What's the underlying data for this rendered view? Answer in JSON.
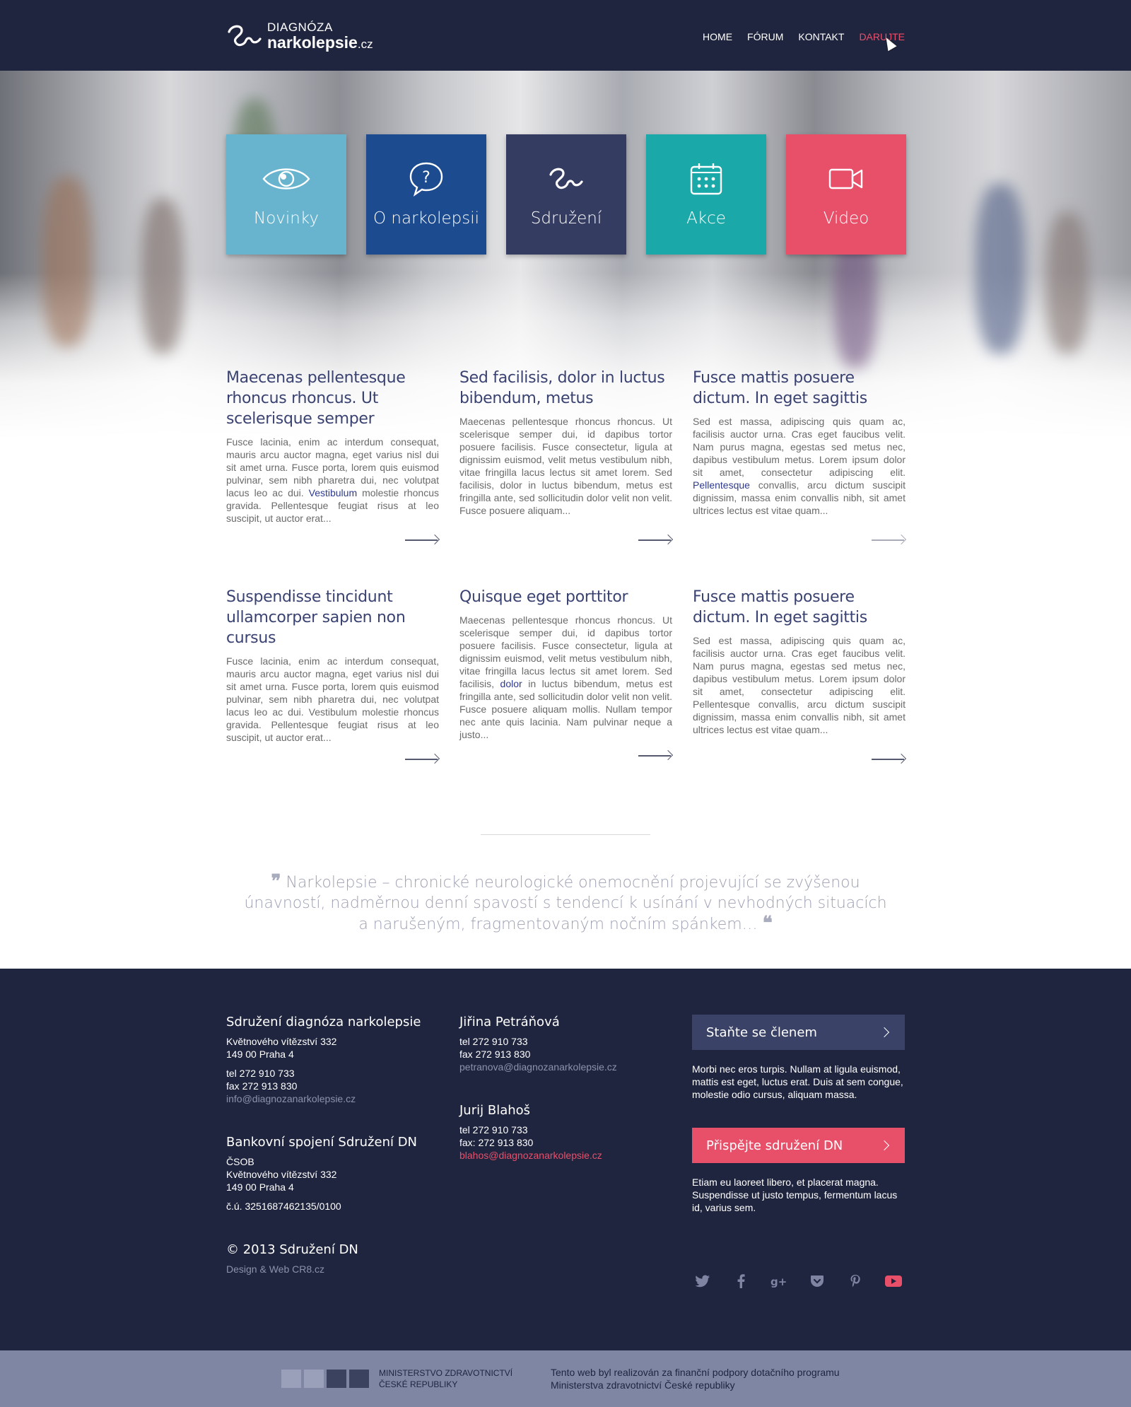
{
  "header": {
    "logo_top": "DIAGNÓZA",
    "logo_main": "narkolepsie",
    "logo_tld": ".cz",
    "nav": [
      "HOME",
      "FÓRUM",
      "KONTAKT",
      "DARUJTE"
    ]
  },
  "tiles": [
    {
      "label": "Novinky",
      "icon": "eye-icon",
      "color": "#68b4cf"
    },
    {
      "label": "O narkolepsii",
      "icon": "question-bubble-icon",
      "color": "#1d4b8f"
    },
    {
      "label": "Sdružení",
      "icon": "logo-mark-icon",
      "color": "#353c62"
    },
    {
      "label": "Akce",
      "icon": "calendar-icon",
      "color": "#1aa9a8"
    },
    {
      "label": "Video",
      "icon": "video-camera-icon",
      "color": "#e8506a"
    }
  ],
  "articles": [
    {
      "title": "Maecenas pellentesque rhoncus rhoncus. Ut scelerisque semper",
      "text_a": "Fusce lacinia, enim ac interdum consequat, mauris arcu auctor magna, eget varius nisl dui sit amet urna. Fusce porta, lorem quis euismod pulvinar, sem nibh pharetra dui, nec volutpat lacus leo ac dui. ",
      "link": "Vestibulum",
      "text_b": " molestie rhoncus gravida. Pellentesque feugiat risus at leo suscipit, ut auctor erat..."
    },
    {
      "title": "Sed facilisis, dolor in luctus bibendum, metus",
      "text_a": "Maecenas pellentesque rhoncus rhoncus. Ut scelerisque semper dui, id dapibus tortor posuere facilisis. Fusce consectetur, ligula at dignissim euismod, velit metus vestibulum nibh, vitae fringilla lacus lectus sit amet lorem. Sed facilisis, dolor in luctus bibendum, metus est fringilla ante, sed sollicitudin dolor velit non velit. Fusce posuere aliquam...",
      "link": "",
      "text_b": ""
    },
    {
      "title": "Fusce mattis posuere dictum. In eget sagittis",
      "text_a": "Sed est massa, adipiscing quis quam ac, facilisis auctor urna. Cras eget faucibus velit. Nam purus magna, egestas sed metus nec, dapibus vestibulum metus. Lorem ipsum dolor sit amet, consectetur adipiscing elit. ",
      "link": "Pellentesque",
      "text_b": " convallis, arcu dictum suscipit dignissim, massa enim convallis nibh, sit amet ultrices lectus est vitae quam..."
    },
    {
      "title": "Suspendisse tincidunt ullamcorper sapien non cursus",
      "text_a": "Fusce lacinia, enim ac interdum consequat, mauris arcu auctor magna, eget varius nisl dui sit amet urna. Fusce porta, lorem quis euismod pulvinar, sem nibh pharetra dui, nec volutpat lacus leo ac dui. Vestibulum molestie rhoncus gravida. Pellentesque feugiat risus at leo suscipit, ut auctor erat...",
      "link": "",
      "text_b": ""
    },
    {
      "title": "Quisque eget porttitor",
      "text_a": "Maecenas pellentesque rhoncus rhoncus. Ut scelerisque semper dui, id dapibus tortor posuere facilisis. Fusce consectetur, ligula at dignissim euismod, velit metus vestibulum nibh, vitae fringilla lacus lectus sit amet lorem. Sed facilisis, ",
      "link": "dolor",
      "text_b": " in luctus bibendum, metus est fringilla ante, sed sollicitudin dolor velit non velit. Fusce posuere aliquam mollis. Nullam tempor nec ante quis lacinia. Nam pulvinar neque a justo..."
    },
    {
      "title": "Fusce mattis posuere dictum. In eget sagittis",
      "text_a": "Sed est massa, adipiscing quis quam ac, facilisis auctor urna. Cras eget faucibus velit. Nam purus magna, egestas sed metus nec, dapibus vestibulum metus. Lorem ipsum dolor sit amet, consectetur adipiscing elit. Pellentesque convallis, arcu dictum suscipit dignissim, massa enim convallis nibh, sit amet ultrices lectus est vitae quam...",
      "link": "",
      "text_b": ""
    }
  ],
  "quote": {
    "open": "❞",
    "text": "Narkolepsie – chronické neurologické onemocnění projevující se zvýšenou únavností, nadměrnou denní spavostí s tendencí k usínání v nevhodných situacích a narušeným, fragmentovaným nočním spánkem…",
    "close": "❝"
  },
  "footer": {
    "org": {
      "title": "Sdružení diagnóza narkolepsie",
      "street": "Květnového vítězství 332",
      "city": "149 00 Praha 4",
      "tel": "tel 272 910 733",
      "fax": "fax 272 913 830",
      "email": "info@diagnozanarkolepsie.cz"
    },
    "bank": {
      "title": "Bankovní spojení Sdružení DN",
      "bank_name": "ČSOB",
      "street": "Květnového vítězství 332",
      "city": "149 00 Praha 4",
      "account": "č.ú. 3251687462135/0100"
    },
    "copyright": "© 2013 Sdružení DN",
    "credit": "Design & Web CR8.cz",
    "contact1": {
      "name": "Jiřina Petráňová",
      "tel": "tel 272 910 733",
      "fax": "fax 272 913 830",
      "email": "petranova@diagnozanarkolepsie.cz"
    },
    "contact2": {
      "name": "Jurij Blahoš",
      "tel": "tel 272 910 733",
      "fax": "fax: 272 913 830",
      "email": "blahos@diagnozanarkolepsie.cz"
    },
    "member_cta": "Staňte se členem",
    "member_text": "Morbi nec eros turpis. Nullam at ligula euismod, mattis est eget, luctus erat. Duis at sem congue, molestie odio cursus, aliquam massa.",
    "donate_cta": "Přispějte sdružení DN",
    "donate_text": "Etiam eu laoreet libero, et placerat magna. Suspendisse ut justo tempus, fermentum lacus id, varius sem.",
    "social": [
      "twitter-icon",
      "facebook-icon",
      "google-plus-icon",
      "pocket-icon",
      "pinterest-icon",
      "youtube-icon"
    ]
  },
  "subfooter": {
    "ministry_line1": "MINISTERSTVO ZDRAVOTNICTVÍ",
    "ministry_line2": "ČESKÉ REPUBLIKY",
    "funded_line1": "Tento web byl realizován za finanční podpory dotačního programu",
    "funded_line2": "Ministerstva zdravotnictví České republiky"
  }
}
